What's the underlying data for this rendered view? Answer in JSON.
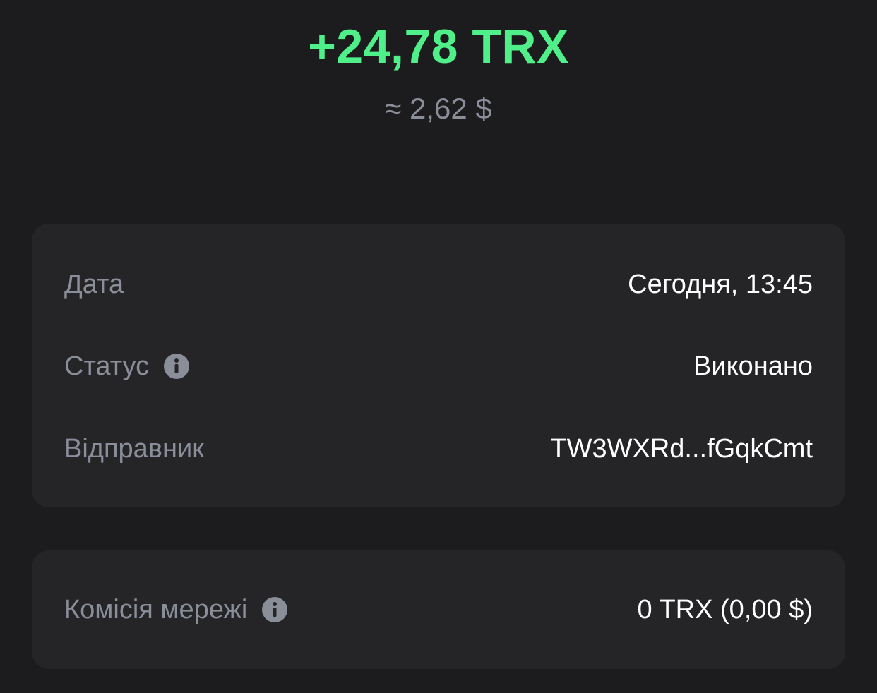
{
  "header": {
    "amount": "+24,78 TRX",
    "approx_value": "≈ 2,62 $"
  },
  "details": {
    "date": {
      "label": "Дата",
      "value": "Сегодня, 13:45"
    },
    "status": {
      "label": "Статус",
      "value": "Виконано",
      "icon": "info-icon"
    },
    "sender": {
      "label": "Відправник",
      "value": "TW3WXRd...fGqkCmt"
    }
  },
  "fee": {
    "label": "Комісія мережі",
    "value": "0 TRX (0,00 $)",
    "icon": "info-icon"
  },
  "colors": {
    "background": "#1c1c1e",
    "card": "#252528",
    "accent_green": "#4ff08a",
    "secondary_text": "#8a8e99",
    "primary_text": "#ffffff"
  }
}
